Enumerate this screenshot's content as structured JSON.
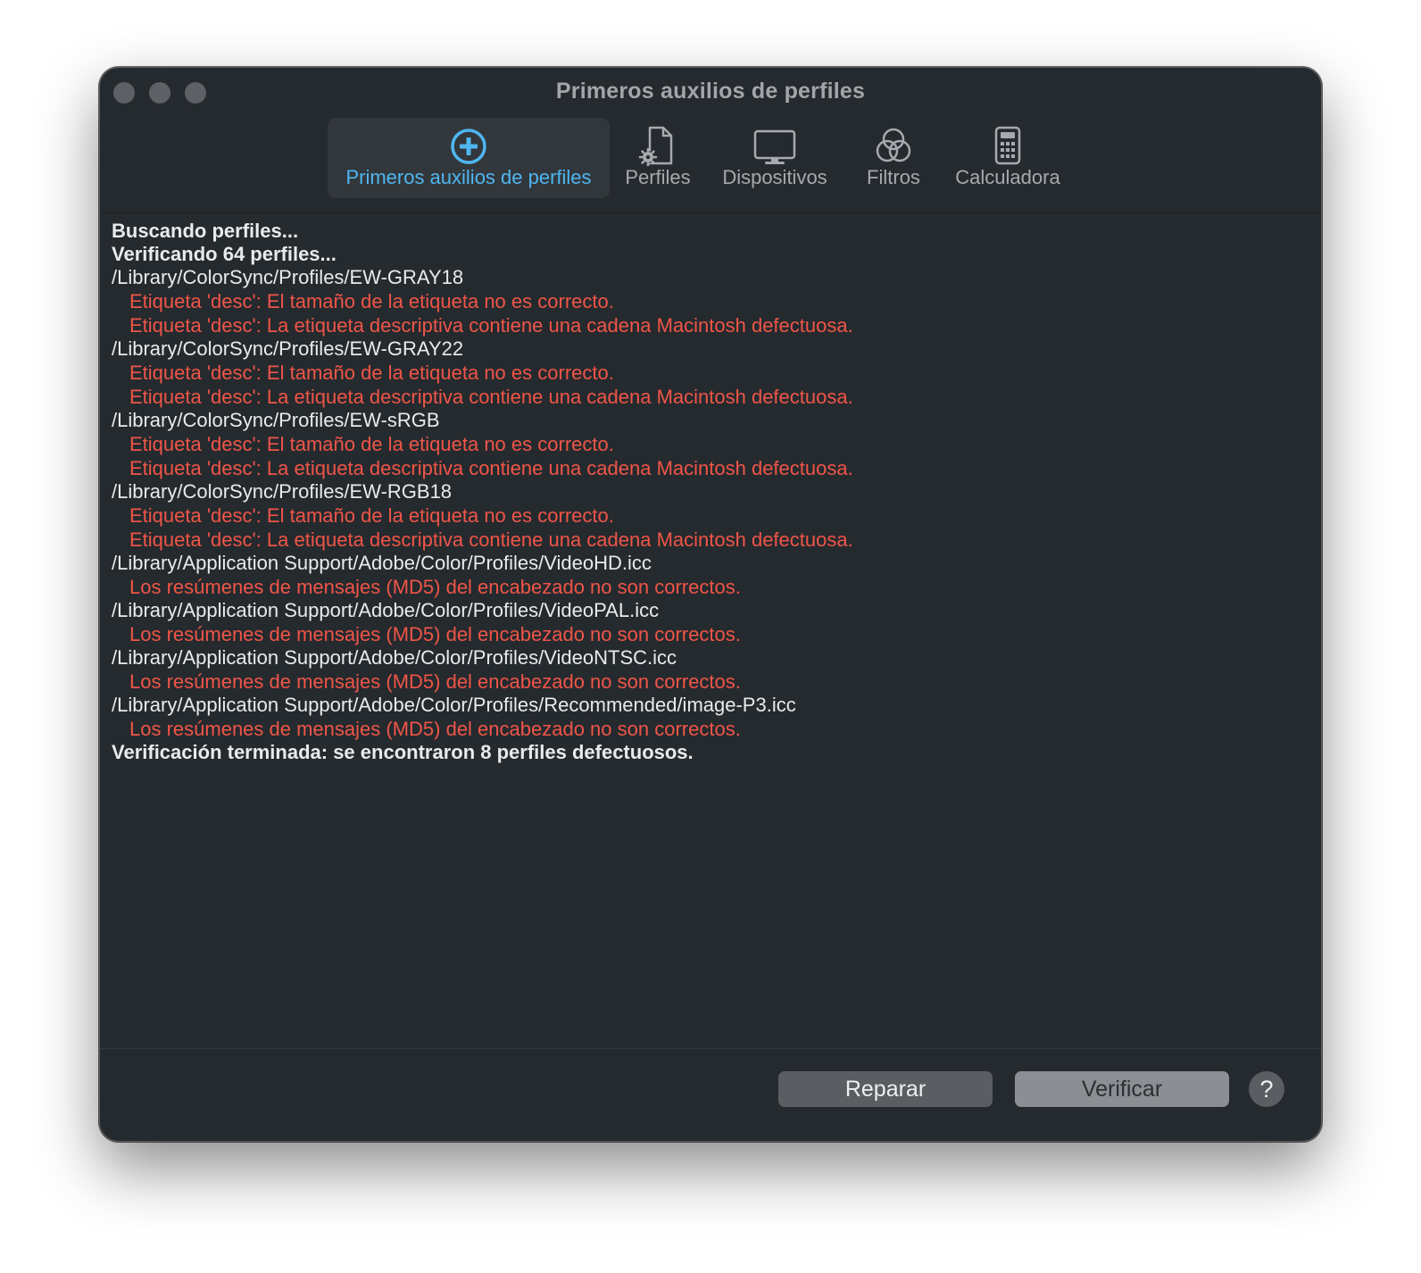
{
  "window": {
    "title": "Primeros auxilios de perfiles"
  },
  "toolbar": {
    "tabs": [
      {
        "label": "Primeros auxilios de perfiles",
        "icon": "plus-circle-icon",
        "active": true
      },
      {
        "label": "Perfiles",
        "icon": "document-gear-icon",
        "active": false
      },
      {
        "label": "Dispositivos",
        "icon": "display-icon",
        "active": false
      },
      {
        "label": "Filtros",
        "icon": "color-circles-icon",
        "active": false
      },
      {
        "label": "Calculadora",
        "icon": "calculator-icon",
        "active": false
      }
    ]
  },
  "log": {
    "searching": "Buscando perfiles...",
    "verifying": "Verificando 64 perfiles...",
    "entries": [
      {
        "path": "/Library/ColorSync/Profiles/EW-GRAY18",
        "errors": [
          "Etiqueta 'desc': El tamaño de la etiqueta no es correcto.",
          "Etiqueta 'desc': La etiqueta descriptiva contiene una cadena Macintosh defectuosa."
        ]
      },
      {
        "path": "/Library/ColorSync/Profiles/EW-GRAY22",
        "errors": [
          "Etiqueta 'desc': El tamaño de la etiqueta no es correcto.",
          "Etiqueta 'desc': La etiqueta descriptiva contiene una cadena Macintosh defectuosa."
        ]
      },
      {
        "path": "/Library/ColorSync/Profiles/EW-sRGB",
        "errors": [
          "Etiqueta 'desc': El tamaño de la etiqueta no es correcto.",
          "Etiqueta 'desc': La etiqueta descriptiva contiene una cadena Macintosh defectuosa."
        ]
      },
      {
        "path": "/Library/ColorSync/Profiles/EW-RGB18",
        "errors": [
          "Etiqueta 'desc': El tamaño de la etiqueta no es correcto.",
          "Etiqueta 'desc': La etiqueta descriptiva contiene una cadena Macintosh defectuosa."
        ]
      },
      {
        "path": "/Library/Application Support/Adobe/Color/Profiles/VideoHD.icc",
        "errors": [
          "Los resúmenes de mensajes (MD5) del encabezado no son correctos."
        ]
      },
      {
        "path": "/Library/Application Support/Adobe/Color/Profiles/VideoPAL.icc",
        "errors": [
          "Los resúmenes de mensajes (MD5) del encabezado no son correctos."
        ]
      },
      {
        "path": "/Library/Application Support/Adobe/Color/Profiles/VideoNTSC.icc",
        "errors": [
          "Los resúmenes de mensajes (MD5) del encabezado no son correctos."
        ]
      },
      {
        "path": "/Library/Application Support/Adobe/Color/Profiles/Recommended/image-P3.icc",
        "errors": [
          "Los resúmenes de mensajes (MD5) del encabezado no son correctos."
        ]
      }
    ],
    "summary": "Verificación terminada: se encontraron 8 perfiles defectuosos."
  },
  "footer": {
    "repair_label": "Reparar",
    "verify_label": "Verificar",
    "help_label": "?"
  },
  "colors": {
    "window_bg": "#252a2e",
    "accent": "#4fb6f0",
    "error": "#ef5548",
    "text": "#e9eaeb"
  }
}
